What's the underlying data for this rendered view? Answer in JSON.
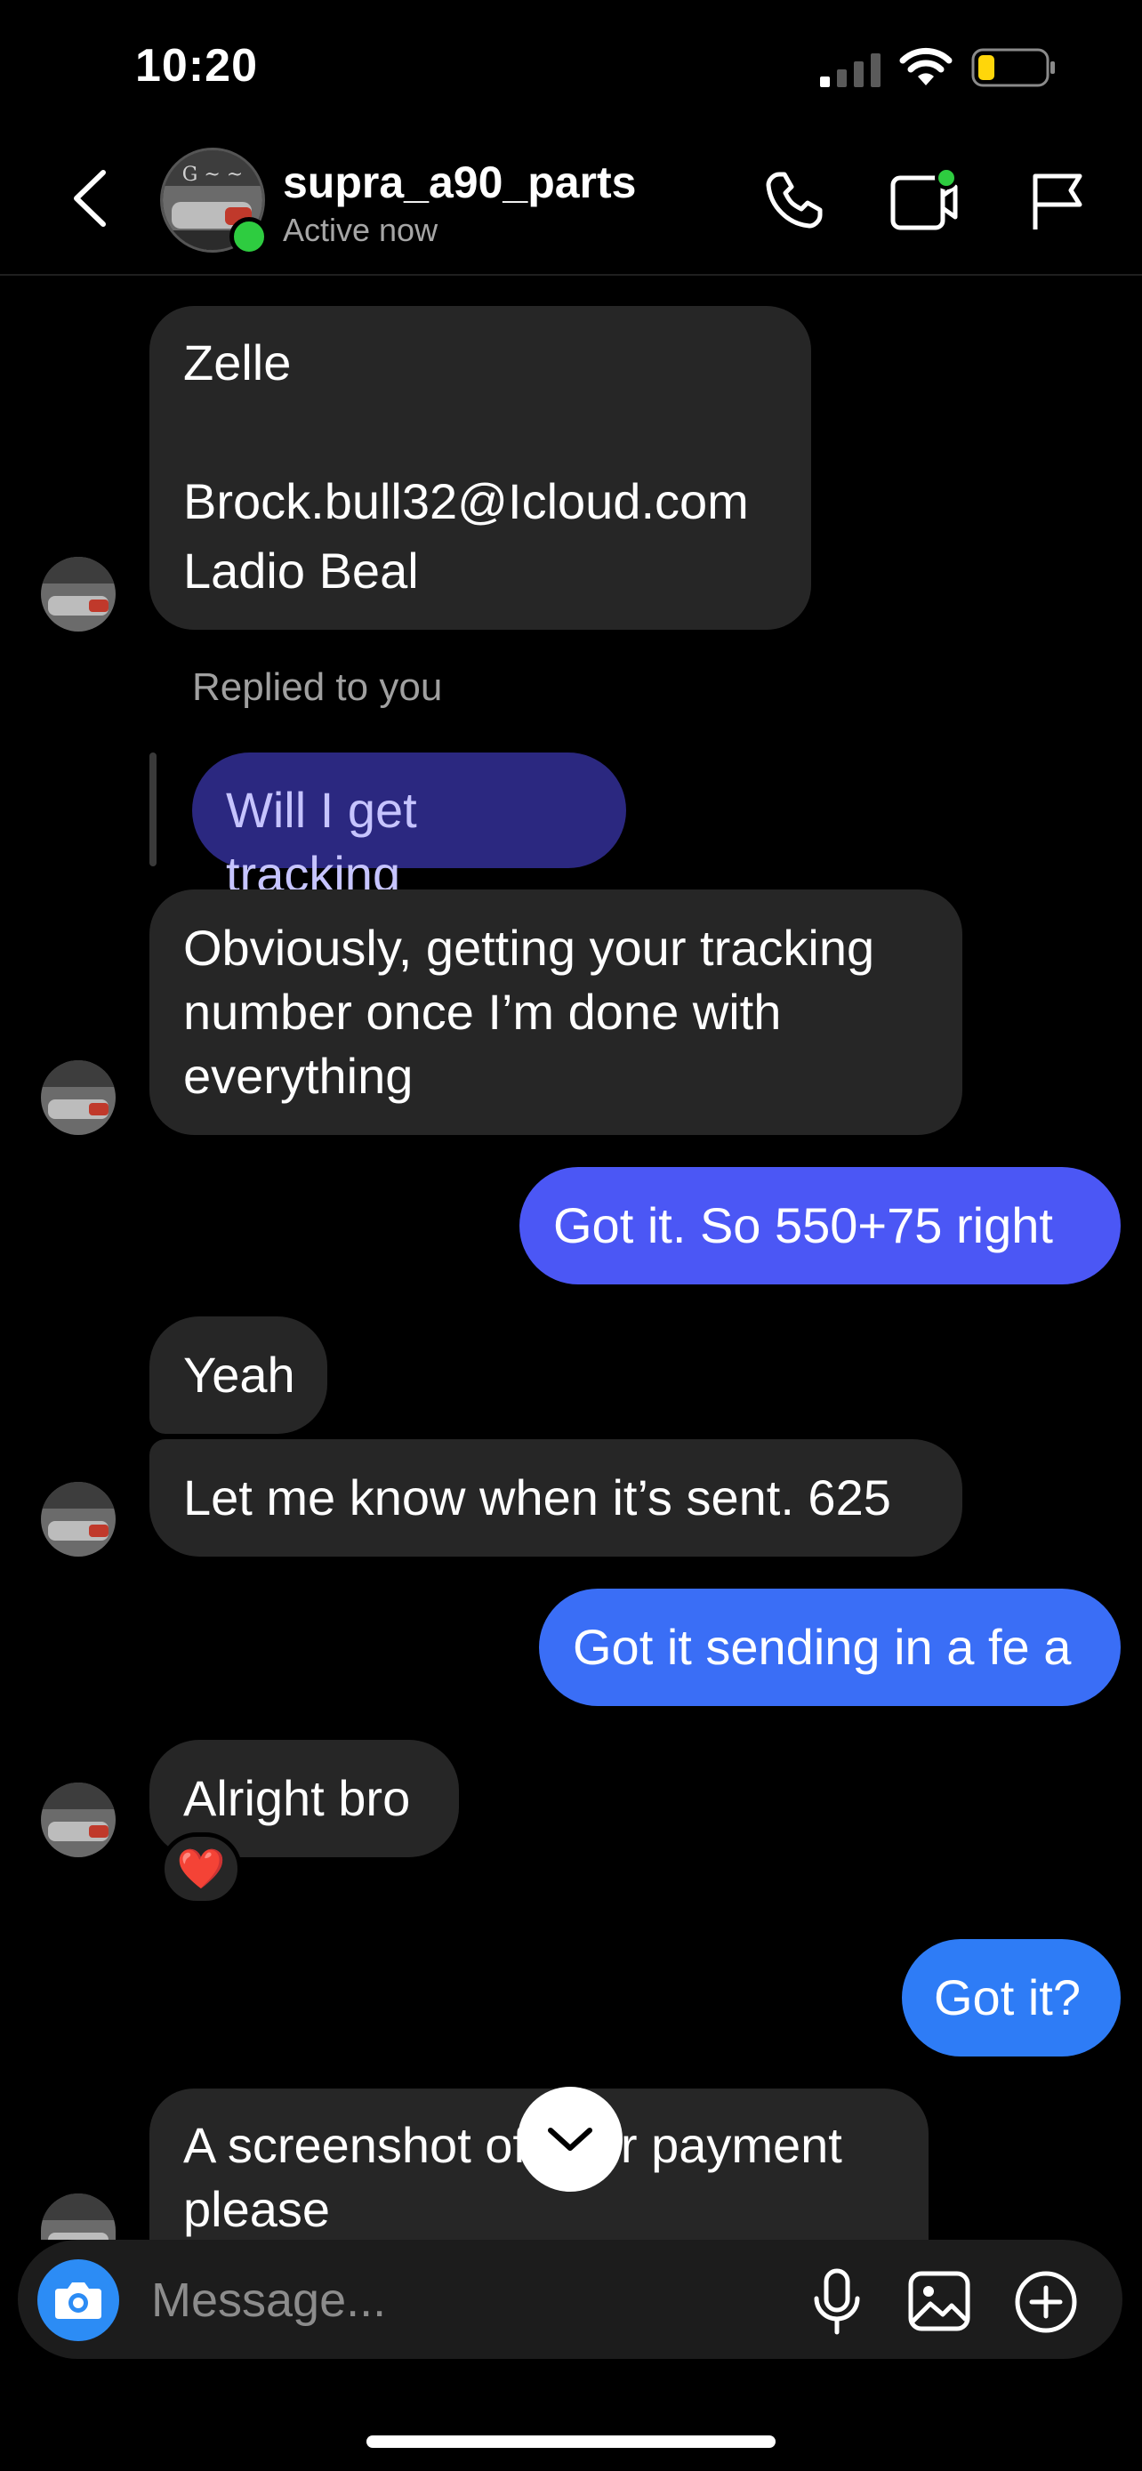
{
  "status_bar": {
    "time": "10:20",
    "battery_level": 0.25,
    "battery_color": "#ffd60a"
  },
  "header": {
    "username": "supra_a90_parts",
    "status": "Active now",
    "online_color": "#2ecc40"
  },
  "messages": {
    "m1": {
      "lines": [
        "Zelle",
        "",
        "Brock.bull32@Icloud.com",
        "Ladio Beal"
      ]
    },
    "reply_note": "Replied to you",
    "reply_quote": "Will I get tracking",
    "m2": {
      "lines": [
        "Obviously, getting your tracking",
        "number once I’m done with",
        "everything"
      ]
    },
    "m3": "Got it. So 550+75 right",
    "m4": "Yeah",
    "m5": "Let me know when it’s sent. 625",
    "m6": "Got it sending in a fe a",
    "m7": "Alright bro",
    "m7_reaction": "❤️",
    "m8": "Got it?",
    "m9": {
      "lines": [
        "A screenshot of your payment",
        "please"
      ]
    }
  },
  "composer": {
    "placeholder": "Message..."
  },
  "colors": {
    "incoming": "#262626",
    "outgoing_purple": "#4b57f5",
    "outgoing_blue": "#2e7cf6",
    "accent": "#2c8cf5"
  }
}
